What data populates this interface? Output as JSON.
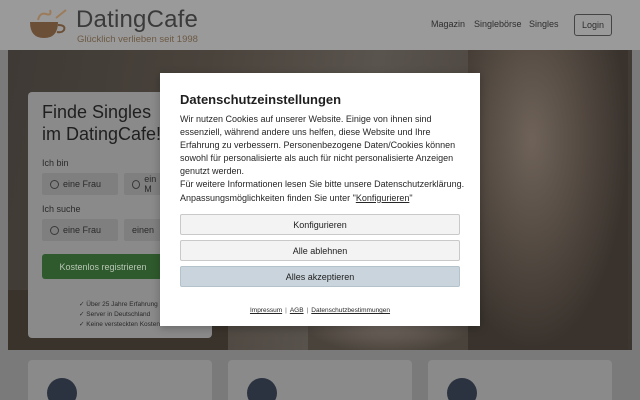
{
  "header": {
    "brand": "DatingCafe",
    "tagline": "Glücklich verlieben seit 1998",
    "nav": [
      "Magazin",
      "Singlebörse",
      "Singles"
    ],
    "login_label": "Login"
  },
  "signup": {
    "title": "Finde Singles im DatingCafe!",
    "ich_bin_label": "Ich bin",
    "ich_suche_label": "Ich suche",
    "option_frau": "eine Frau",
    "option_mann_partial": "ein M",
    "option_mann_partial_2": "einen",
    "register_label": "Kostenlos registrieren",
    "bullets": [
      "✓ Über 25 Jahre Erfahrung",
      "✓ Server in Deutschland",
      "✓ Keine versteckten Kosten"
    ]
  },
  "modal": {
    "title": "Datenschutzeinstellungen",
    "paragraph1": "Wir nutzen Cookies auf unserer Website. Einige von ihnen sind essenziell, während andere uns helfen, diese Website und Ihre Erfahrung zu verbessern. Personenbezogene Daten/Cookies können sowohl für personalisierte als auch für nicht personalisierte Anzeigen genutzt werden.",
    "paragraph2_prefix": "Für weitere Informationen lesen Sie bitte unsere Datenschutzerklärung. Anpassungsmöglichkeiten finden Sie unter \"",
    "paragraph2_link": "Konfigurieren",
    "paragraph2_suffix": "\"",
    "buttons": {
      "configure": "Konfigurieren",
      "reject_all": "Alle ablehnen",
      "accept_all": "Alles akzeptieren"
    },
    "footer_links": [
      "Impressum",
      "AGB",
      "Datenschutzbestimmungen"
    ],
    "footer_separator": "|"
  },
  "colors": {
    "accent_green": "#2f5a2d",
    "accept_button": "#c9d4dc",
    "overlay_dim": "#7a7a7a"
  }
}
